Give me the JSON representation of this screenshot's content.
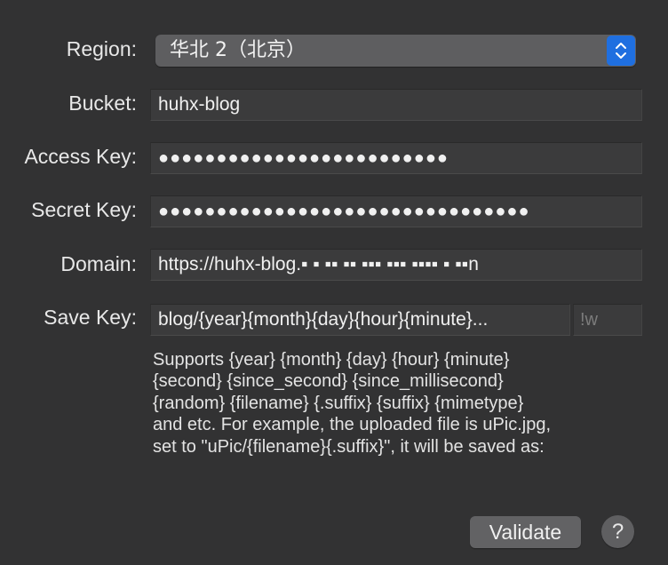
{
  "form": {
    "region": {
      "label": "Region:",
      "value": "华北 2（北京）"
    },
    "bucket": {
      "label": "Bucket:",
      "value": "huhx-blog"
    },
    "access_key": {
      "label": "Access Key:",
      "value": "●●●●●●●●●●●●●●●●●●●●●●●●●"
    },
    "secret_key": {
      "label": "Secret Key:",
      "value": "●●●●●●●●●●●●●●●●●●●●●●●●●●●●●●●●"
    },
    "domain": {
      "label": "Domain:",
      "value": "https://huhx-blog.▪ ▪ ▪▪ ▪▪ ▪▪▪ ▪▪▪ ▪▪▪▪ ▪ ▪▪n"
    },
    "save_key": {
      "label": "Save Key:",
      "value": "blog/{year}{month}{day}{hour}{minute}...",
      "suffix_placeholder": "!w"
    },
    "help_lines": [
      "Supports {year} {month} {day} {hour} {minute}",
      "{second} {since_second} {since_millisecond}",
      "{random} {filename} {.suffix} {suffix} {mimetype}",
      "and etc. For example, the uploaded file is uPic.jpg,",
      "set to \"uPic/{filename}{.suffix}\", it will be saved as:"
    ]
  },
  "buttons": {
    "validate": "Validate",
    "help": "?"
  },
  "colors": {
    "background": "#323233",
    "accent": "#1f6fe0"
  },
  "icons": {
    "select_stepper": "up-down-chevron-icon"
  }
}
